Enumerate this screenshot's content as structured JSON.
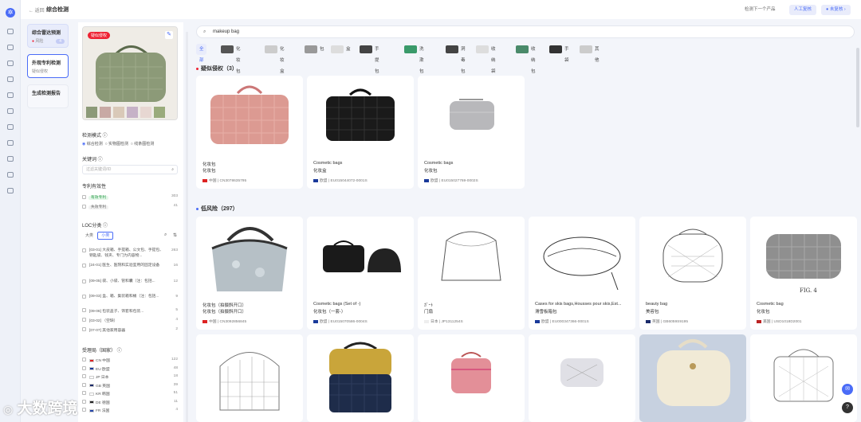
{
  "header": {
    "back": "← 返回",
    "title": "综合检测",
    "next": "检测下一个产品",
    "manual": "人工复核",
    "unreviewed": "未复核"
  },
  "steps": [
    {
      "title": "综合雷达预测",
      "sub": "风险",
      "badge": "4"
    },
    {
      "title": "外观专利检测",
      "sub": "疑似侵权"
    },
    {
      "title": "生成检测报告",
      "sub": ""
    }
  ],
  "filter": {
    "product_badge": "疑似侵权",
    "mode_title": "检测模式",
    "modes": [
      "综合检测",
      "实物图检测",
      "线条图检测"
    ],
    "keyword_title": "关键词",
    "keyword_placeholder": "过滤关键词/ID",
    "validity_title": "专利有效性",
    "validity": [
      {
        "label": "有效专利",
        "count": "303"
      },
      {
        "label": "失效专利",
        "count": "41"
      }
    ],
    "loc_title": "LOC分类",
    "loc_tabs": [
      "大类",
      "小类"
    ],
    "loc_items": [
      {
        "label": "[03-01] 大皮箱、手提箱、公文包、手提包、钥匙袋、钱夹、专门为内容物...",
        "count": "263"
      },
      {
        "label": "[24-01] 医生、医院和实验室用的固定设备",
        "count": "16"
      },
      {
        "label": "[09-05] 袋、小袋、管和囊（注：包括...",
        "count": "12"
      },
      {
        "label": "[09-03] 盒、箱、集装箱和桶（注：包括...",
        "count": "9"
      },
      {
        "label": "[09-06] 包装盖子、饰套和包装...",
        "count": "5"
      },
      {
        "label": "[03-02] （空缺）",
        "count": "4"
      },
      {
        "label": "[07-07] 其他家用容器",
        "count": "2"
      }
    ],
    "region_title": "受理局（国家）",
    "regions": [
      {
        "code": "CN",
        "name": "中国",
        "count": "122",
        "color": "#d22"
      },
      {
        "code": "EU",
        "name": "欧盟",
        "count": "48",
        "color": "#1a3a9a"
      },
      {
        "code": "JP",
        "name": "日本",
        "count": "18",
        "color": "#fff"
      },
      {
        "code": "GB",
        "name": "英国",
        "count": "39",
        "color": "#1a2a6a"
      },
      {
        "code": "KR",
        "name": "韩国",
        "count": "51",
        "color": "#fff"
      },
      {
        "code": "DE",
        "name": "德国",
        "count": "11",
        "color": "#222"
      },
      {
        "code": "FR",
        "name": "法国",
        "count": "4",
        "color": "#2244aa"
      }
    ]
  },
  "search": {
    "query": "makeup bag"
  },
  "categories": [
    "全部",
    "化妆包",
    "化妆盒",
    "包",
    "盒",
    "手提包",
    "洗漱包",
    "洞毒包",
    "收纳袋",
    "收纳包",
    "手袋",
    "其他"
  ],
  "sections": [
    {
      "title": "疑似侵权（3）"
    },
    {
      "title": "低风险（297）"
    }
  ],
  "cards_top": [
    {
      "name1": "化妆包",
      "name2": "化妆包",
      "country": "中国",
      "id": "CN3078635795",
      "flag": "#d22",
      "img": "pink"
    },
    {
      "name1": "Cosmetic bags",
      "name2": "化妆盒",
      "country": "欧盟",
      "id": "EU015044072-0001S",
      "flag": "#1a3a9a",
      "img": "black"
    },
    {
      "name1": "Cosmetic bags",
      "name2": "化妆包",
      "country": "欧盟",
      "id": "EU015027769-0002S",
      "flag": "#1a3a9a",
      "img": "grey"
    }
  ],
  "cards_low": [
    {
      "name1": "化妆包（拍摄斜开口）",
      "name2": "化妆包（拍摄斜开口）",
      "country": "中国",
      "id": "CN3092856845",
      "flag": "#d22",
      "img": "quilt"
    },
    {
      "name1": "Cosmetic bags (Set of -)",
      "name2": "化妆包（一套-）",
      "country": "欧盟",
      "id": "EU015070586-0004S",
      "flag": "#1a3a9a",
      "img": "set"
    },
    {
      "name1": "ｶﾞｰﾄ",
      "name2": "门扇",
      "country": "日本",
      "id": "JP1311254S",
      "flag": "#eee",
      "img": "line"
    },
    {
      "name1": "Cases for skis bags,Housses pour skis,Est...",
      "name2": "滑雪板箱包",
      "country": "欧盟",
      "id": "EU000347366-0001S",
      "flag": "#1a3a9a",
      "img": "line2"
    },
    {
      "name1": "beauty bag",
      "name2": "美容包",
      "country": "英国",
      "id": "GB6059S9195",
      "flag": "#1a2a6a",
      "img": "line3"
    },
    {
      "name1": "Cosmetic bag",
      "name2": "化妆包",
      "country": "美国",
      "id": "USD1018D2001",
      "flag": "#b22",
      "img": "fig"
    }
  ],
  "colors": {
    "accent": "#4a6cf7",
    "risk": "#e23",
    "green_tag": "#2a9d4a"
  },
  "watermark": "大数跨境"
}
